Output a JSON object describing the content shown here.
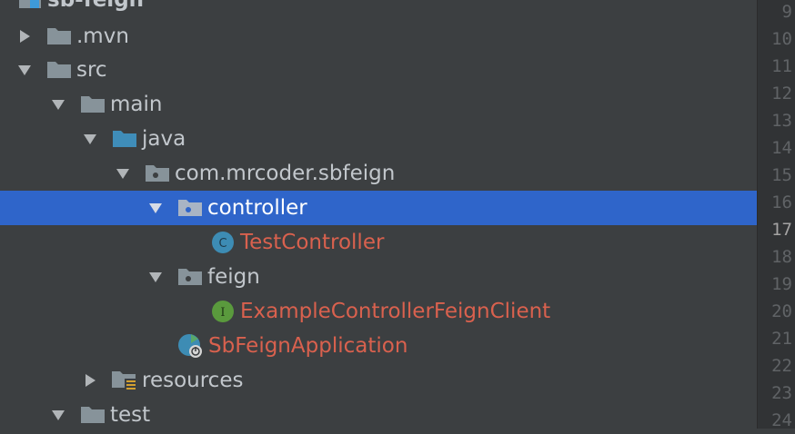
{
  "project_tree": {
    "root": "sb-feign",
    "items": [
      {
        "label": "sb-feign",
        "icon": "module-folder-icon"
      },
      {
        "label": ".mvn",
        "icon": "folder-icon"
      },
      {
        "label": "src",
        "icon": "folder-icon"
      },
      {
        "label": "main",
        "icon": "folder-icon"
      },
      {
        "label": "java",
        "icon": "source-root-folder-icon"
      },
      {
        "label": "com.mrcoder.sbfeign",
        "icon": "package-icon"
      },
      {
        "label": "controller",
        "icon": "package-icon",
        "selected": true
      },
      {
        "label": "TestController",
        "icon": "class-icon",
        "badge": "C"
      },
      {
        "label": "feign",
        "icon": "package-icon"
      },
      {
        "label": "ExampleControllerFeignClient",
        "icon": "interface-icon",
        "badge": "I"
      },
      {
        "label": "SbFeignApplication",
        "icon": "spring-boot-application-icon"
      },
      {
        "label": "resources",
        "icon": "resources-folder-icon"
      },
      {
        "label": "test",
        "icon": "folder-icon"
      }
    ]
  },
  "gutter": {
    "line_numbers": [
      "9",
      "10",
      "11",
      "12",
      "13",
      "14",
      "15",
      "16",
      "17",
      "18",
      "19",
      "20",
      "21",
      "22",
      "23",
      "24"
    ],
    "current_line": "17"
  },
  "colors": {
    "background": "#3c3f41",
    "selection": "#2f65ca",
    "modified_file": "#d9614e",
    "folder": "#87939a",
    "source_folder": "#3f8db9"
  }
}
